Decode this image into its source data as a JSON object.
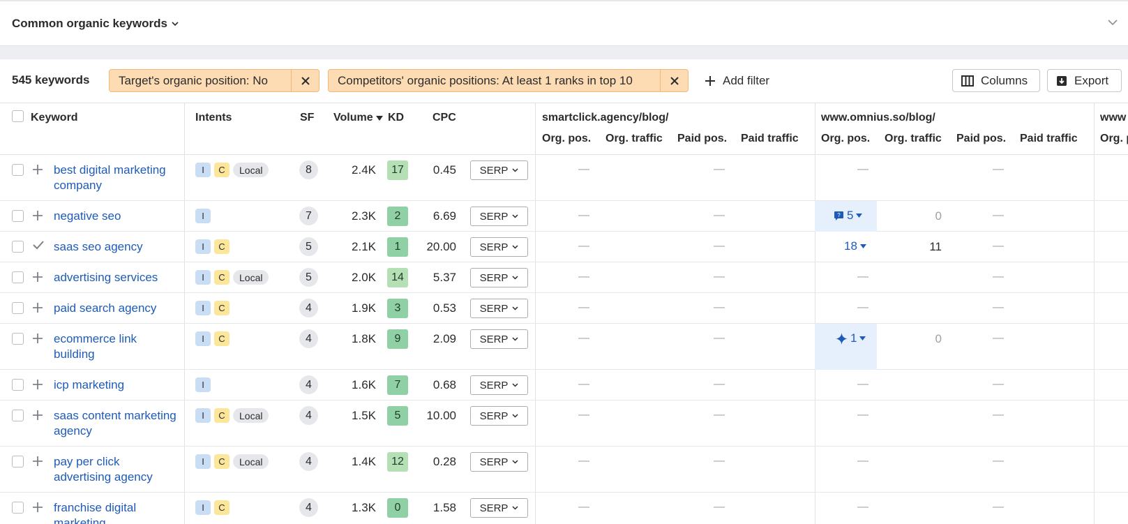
{
  "panel": {
    "title": "Common organic keywords"
  },
  "toolbar": {
    "count": "545 keywords",
    "filters": [
      {
        "label": "Target's organic position: No"
      },
      {
        "label": "Competitors' organic positions: At least 1 ranks in top 10"
      }
    ],
    "add_filter": "Add filter",
    "columns_label": "Columns",
    "export_label": "Export"
  },
  "columns": {
    "keyword": "Keyword",
    "intents": "Intents",
    "sf": "SF",
    "volume": "Volume",
    "kd": "KD",
    "cpc": "CPC",
    "competitors": [
      {
        "domain": "smartclick.agency/blog/"
      },
      {
        "domain": "www.omnius.so/blog/"
      },
      {
        "domain": "www"
      }
    ],
    "sub": [
      "Org. pos.",
      "Org. traffic",
      "Paid pos.",
      "Paid traffic"
    ],
    "partial_sub": "Org. p"
  },
  "rows": [
    {
      "keyword": "best digital marketing company",
      "intents": [
        "I",
        "C",
        "Local"
      ],
      "sf": "8",
      "volume": "2.4K",
      "kd": "17",
      "cpc": "0.45",
      "serp": "SERP",
      "omnius_pos": "",
      "omnius_traffic": "",
      "added": false
    },
    {
      "keyword": "negative seo",
      "intents": [
        "I"
      ],
      "sf": "7",
      "volume": "2.3K",
      "kd": "2",
      "cpc": "6.69",
      "serp": "SERP",
      "omnius_pos": "5",
      "omnius_traffic": "0",
      "added": false
    },
    {
      "keyword": "saas seo agency",
      "intents": [
        "I",
        "C"
      ],
      "sf": "5",
      "volume": "2.1K",
      "kd": "1",
      "cpc": "20.00",
      "serp": "SERP",
      "omnius_pos": "18",
      "omnius_traffic": "11",
      "added": true
    },
    {
      "keyword": "advertising services",
      "intents": [
        "I",
        "C",
        "Local"
      ],
      "sf": "5",
      "volume": "2.0K",
      "kd": "14",
      "cpc": "5.37",
      "serp": "SERP",
      "omnius_pos": "",
      "omnius_traffic": "",
      "added": false
    },
    {
      "keyword": "paid search agency",
      "intents": [
        "I",
        "C"
      ],
      "sf": "4",
      "volume": "1.9K",
      "kd": "3",
      "cpc": "0.53",
      "serp": "SERP",
      "omnius_pos": "",
      "omnius_traffic": "",
      "added": false
    },
    {
      "keyword": "ecommerce link building",
      "intents": [
        "I",
        "C"
      ],
      "sf": "4",
      "volume": "1.8K",
      "kd": "9",
      "cpc": "2.09",
      "serp": "SERP",
      "omnius_pos": "1",
      "omnius_traffic": "0",
      "added": false
    },
    {
      "keyword": "icp marketing",
      "intents": [
        "I"
      ],
      "sf": "4",
      "volume": "1.6K",
      "kd": "7",
      "cpc": "0.68",
      "serp": "SERP",
      "omnius_pos": "",
      "omnius_traffic": "",
      "added": false
    },
    {
      "keyword": "saas content marketing agency",
      "intents": [
        "I",
        "C",
        "Local"
      ],
      "sf": "4",
      "volume": "1.5K",
      "kd": "5",
      "cpc": "10.00",
      "serp": "SERP",
      "omnius_pos": "",
      "omnius_traffic": "",
      "added": false
    },
    {
      "keyword": "pay per click advertising agency",
      "intents": [
        "I",
        "C",
        "Local"
      ],
      "sf": "4",
      "volume": "1.4K",
      "kd": "12",
      "cpc": "0.28",
      "serp": "SERP",
      "omnius_pos": "",
      "omnius_traffic": "",
      "added": false
    },
    {
      "keyword": "franchise digital marketing",
      "intents": [
        "I",
        "C"
      ],
      "sf": "4",
      "volume": "1.3K",
      "kd": "0",
      "cpc": "1.58",
      "serp": "SERP",
      "omnius_pos": "",
      "omnius_traffic": "",
      "added": false
    }
  ],
  "colors": {
    "link": "#1e5bb8",
    "filter_chip": "#fddcb4",
    "intent_i": "#c9ddf5",
    "intent_c": "#fbe69a",
    "kd_low": "#8fd0a4",
    "kd_mid": "#b5dfb5",
    "highlight": "#e5f0fc"
  },
  "icons": {
    "dash": "—",
    "dropdown": "chevron-down-icon",
    "serp_feature_review": "chat-icon",
    "serp_feature_ai": "sparkle-icon"
  }
}
